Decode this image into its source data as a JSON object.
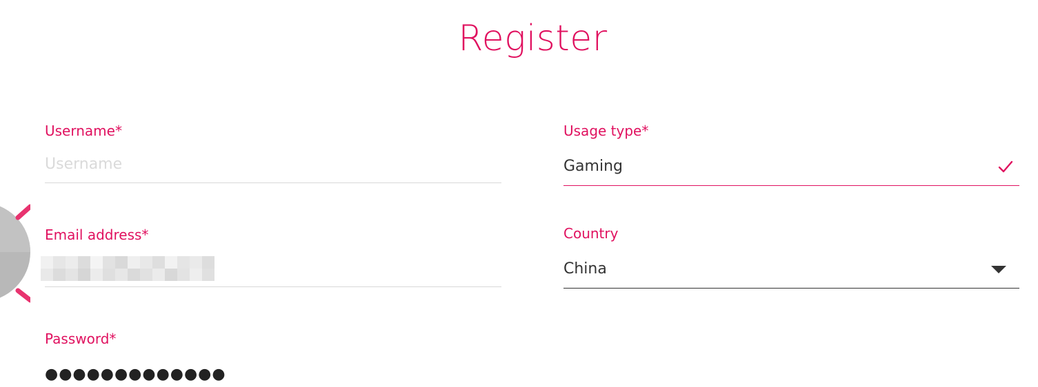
{
  "page": {
    "title": "Register"
  },
  "form": {
    "username": {
      "label": "Username*",
      "placeholder": "Username",
      "value": ""
    },
    "email": {
      "label": "Email address*",
      "value": "",
      "obscured": true
    },
    "password": {
      "label": "Password*",
      "masked_value": "●●●●●●●●●●●●●"
    },
    "usage_type": {
      "label": "Usage type*",
      "value": "Gaming",
      "status_icon": "check-icon"
    },
    "country": {
      "label": "Country",
      "value": "China",
      "options_icon": "caret-down-icon"
    }
  },
  "colors": {
    "accent": "#e0115f",
    "text": "#333333",
    "divider": "#d8d8d8"
  }
}
